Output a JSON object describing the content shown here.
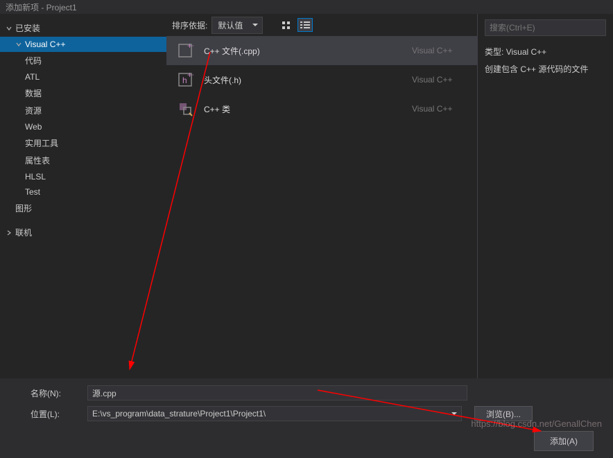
{
  "title": "添加新项 - Project1",
  "sidebar": {
    "installed": "已安装",
    "vcpp": "Visual C++",
    "items": [
      "代码",
      "ATL",
      "数据",
      "资源",
      "Web",
      "实用工具",
      "属性表",
      "HLSL",
      "Test"
    ],
    "graphics": "图形",
    "online": "联机"
  },
  "toolbar": {
    "sort_label": "排序依据:",
    "sort_value": "默认值"
  },
  "templates": [
    {
      "name": "C++ 文件(.cpp)",
      "lang": "Visual C++",
      "icon": "cpp"
    },
    {
      "name": "头文件(.h)",
      "lang": "Visual C++",
      "icon": "h"
    },
    {
      "name": "C++ 类",
      "lang": "Visual C++",
      "icon": "class"
    }
  ],
  "right": {
    "search_placeholder": "搜索(Ctrl+E)",
    "type_label": "类型:",
    "type_value": "Visual C++",
    "desc": "创建包含 C++ 源代码的文件"
  },
  "form": {
    "name_label": "名称(N):",
    "name_value": "源.cpp",
    "path_label": "位置(L):",
    "path_value": "E:\\vs_program\\data_strature\\Project1\\Project1\\",
    "browse": "浏览(B)...",
    "add": "添加(A)"
  },
  "watermark": "https://blog.csdn.net/GenallChen"
}
